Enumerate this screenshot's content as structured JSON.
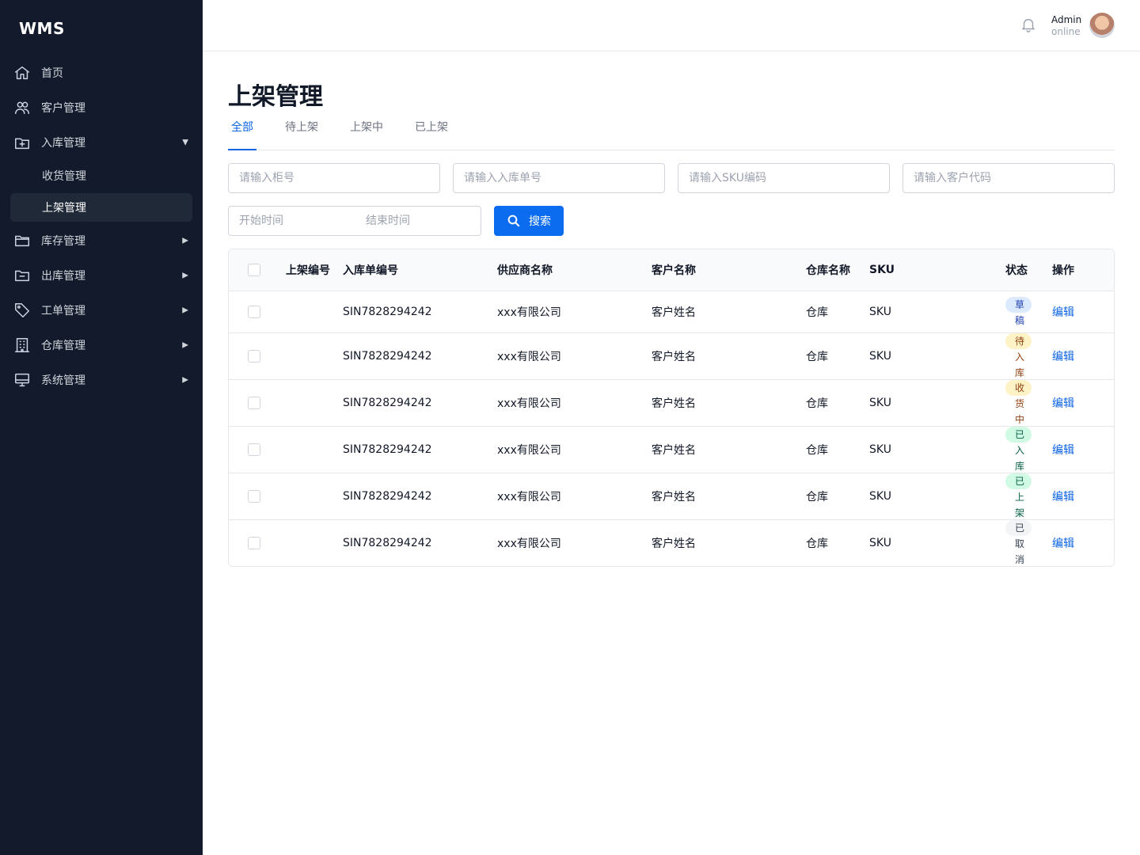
{
  "app": {
    "logo": "WMS"
  },
  "sidebar": {
    "items": [
      {
        "label": "首页",
        "icon": "home-icon",
        "arrow": ""
      },
      {
        "label": "客户管理",
        "icon": "users-icon",
        "arrow": ""
      },
      {
        "label": "入库管理",
        "icon": "inbox-plus-icon",
        "arrow": "▼"
      },
      {
        "label": "库存管理",
        "icon": "folder-icon",
        "arrow": "▶"
      },
      {
        "label": "出库管理",
        "icon": "folder-minus-icon",
        "arrow": "▶"
      },
      {
        "label": "工单管理",
        "icon": "tag-icon",
        "arrow": "▶"
      },
      {
        "label": "仓库管理",
        "icon": "building-icon",
        "arrow": "▶"
      },
      {
        "label": "系统管理",
        "icon": "monitor-icon",
        "arrow": "▶"
      }
    ],
    "subitems": [
      {
        "label": "收货管理",
        "active": false
      },
      {
        "label": "上架管理",
        "active": true
      }
    ]
  },
  "header": {
    "user_name": "Admin",
    "user_status": "online"
  },
  "page": {
    "title": "上架管理",
    "tabs": [
      "全部",
      "待上架",
      "上架中",
      "已上架"
    ],
    "active_tab": "全部"
  },
  "filters": {
    "container_placeholder": "请输入柜号",
    "inbound_placeholder": "请输入入库单号",
    "sku_placeholder": "请输入SKU编码",
    "customer_placeholder": "请输入客户代码",
    "start_placeholder": "开始时间",
    "end_placeholder": "结束时间",
    "search_label": "搜索"
  },
  "table": {
    "headers": [
      "上架编号",
      "入库单编号",
      "供应商名称",
      "客户名称",
      "仓库名称",
      "SKU",
      "状态",
      "操作"
    ],
    "rows": [
      {
        "shelf_no": "",
        "inbound_no": "SIN7828294242",
        "supplier": "xxx有限公司",
        "customer": "客户姓名",
        "warehouse": "仓库",
        "sku": "SKU",
        "status": "草稿",
        "action": "编辑"
      },
      {
        "shelf_no": "",
        "inbound_no": "SIN7828294242",
        "supplier": "xxx有限公司",
        "customer": "客户姓名",
        "warehouse": "仓库",
        "sku": "SKU",
        "status": "待入库",
        "action": "编辑"
      },
      {
        "shelf_no": "",
        "inbound_no": "SIN7828294242",
        "supplier": "xxx有限公司",
        "customer": "客户姓名",
        "warehouse": "仓库",
        "sku": "SKU",
        "status": "收货中",
        "action": "编辑"
      },
      {
        "shelf_no": "",
        "inbound_no": "SIN7828294242",
        "supplier": "xxx有限公司",
        "customer": "客户姓名",
        "warehouse": "仓库",
        "sku": "SKU",
        "status": "已入库",
        "action": "编辑"
      },
      {
        "shelf_no": "",
        "inbound_no": "SIN7828294242",
        "supplier": "xxx有限公司",
        "customer": "客户姓名",
        "warehouse": "仓库",
        "sku": "SKU",
        "status": "已上架",
        "action": "编辑"
      },
      {
        "shelf_no": "",
        "inbound_no": "SIN7828294242",
        "supplier": "xxx有限公司",
        "customer": "客户姓名",
        "warehouse": "仓库",
        "sku": "SKU",
        "status": "已取消",
        "action": "编辑"
      }
    ],
    "status_colors": {
      "草稿": {
        "bg": "#dbeafe",
        "fg": "#1e40af"
      },
      "待入库": {
        "bg": "#fef3c7",
        "fg": "#92400e"
      },
      "收货中": {
        "bg": "#fef3c7",
        "fg": "#92400e"
      },
      "已入库": {
        "bg": "#d1fae5",
        "fg": "#065f46"
      },
      "已上架": {
        "bg": "#d1fae5",
        "fg": "#065f46"
      },
      "已取消": {
        "bg": "#f3f4f6",
        "fg": "#374151"
      }
    }
  },
  "colors": {
    "sidebar_bg": "#121a2b",
    "accent": "#0b63e5",
    "button": "#0b6cf0"
  }
}
